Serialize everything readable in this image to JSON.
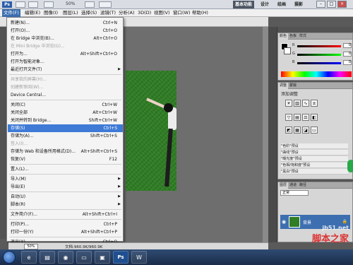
{
  "titlebar": {
    "logo": "Ps",
    "zoom": "50%",
    "workspaces": [
      "基本功能",
      "设计",
      "绘画",
      "摄影"
    ],
    "window_controls": [
      "–",
      "□",
      "×"
    ]
  },
  "menubar": [
    "文件(F)",
    "编辑(E)",
    "图像(I)",
    "图层(L)",
    "选择(S)",
    "滤镜(T)",
    "分析(A)",
    "3D(D)",
    "视图(V)",
    "窗口(W)",
    "帮助(H)"
  ],
  "file_menu": [
    {
      "label": "新建(N)...",
      "shortcut": "Ctrl+N",
      "disabled": false
    },
    {
      "label": "打开(O)...",
      "shortcut": "Ctrl+O",
      "disabled": false
    },
    {
      "label": "在 Bridge 中浏览(B)...",
      "shortcut": "Alt+Ctrl+O",
      "disabled": false
    },
    {
      "label": "在 Mini Bridge 中浏览(G)...",
      "shortcut": "",
      "disabled": true
    },
    {
      "label": "打开为...",
      "shortcut": "Alt+Shift+Ctrl+O",
      "disabled": false
    },
    {
      "label": "打开为智能对象...",
      "shortcut": "",
      "disabled": false
    },
    {
      "label": "最近打开文件(T)",
      "shortcut": "",
      "disabled": false,
      "submenu": true
    },
    {
      "sep": true
    },
    {
      "label": "共享我的屏幕(H)...",
      "shortcut": "",
      "disabled": true
    },
    {
      "label": "创建新审阅(W)...",
      "shortcut": "",
      "disabled": true
    },
    {
      "label": "Device Central...",
      "shortcut": "",
      "disabled": false
    },
    {
      "sep": true
    },
    {
      "label": "关闭(C)",
      "shortcut": "Ctrl+W",
      "disabled": false
    },
    {
      "label": "关闭全部",
      "shortcut": "Alt+Ctrl+W",
      "disabled": false
    },
    {
      "label": "关闭并转到 Bridge...",
      "shortcut": "Shift+Ctrl+W",
      "disabled": false
    },
    {
      "label": "存储(S)",
      "shortcut": "Ctrl+S",
      "disabled": false,
      "highlight": true
    },
    {
      "label": "存储为(A)...",
      "shortcut": "Shift+Ctrl+S",
      "disabled": false
    },
    {
      "label": "签入(I)...",
      "shortcut": "",
      "disabled": true
    },
    {
      "label": "存储为 Web 和设备所用格式(D)...",
      "shortcut": "Alt+Shift+Ctrl+S",
      "disabled": false
    },
    {
      "label": "恢复(V)",
      "shortcut": "F12",
      "disabled": false
    },
    {
      "sep": true
    },
    {
      "label": "置入(L)...",
      "shortcut": "",
      "disabled": false
    },
    {
      "sep": true
    },
    {
      "label": "导入(M)",
      "shortcut": "",
      "disabled": false,
      "submenu": true
    },
    {
      "label": "导出(E)",
      "shortcut": "",
      "disabled": false,
      "submenu": true
    },
    {
      "sep": true
    },
    {
      "label": "自动(U)",
      "shortcut": "",
      "disabled": false,
      "submenu": true
    },
    {
      "label": "脚本(R)",
      "shortcut": "",
      "disabled": false,
      "submenu": true
    },
    {
      "sep": true
    },
    {
      "label": "文件简介(F)...",
      "shortcut": "Alt+Shift+Ctrl+I",
      "disabled": false
    },
    {
      "sep": true
    },
    {
      "label": "打印(P)...",
      "shortcut": "Ctrl+P",
      "disabled": false
    },
    {
      "label": "打印一份(Y)",
      "shortcut": "Alt+Shift+Ctrl+P",
      "disabled": false
    },
    {
      "sep": true
    },
    {
      "label": "退出(X)",
      "shortcut": "Ctrl+Q",
      "disabled": false
    }
  ],
  "color_panel": {
    "tabs": [
      "颜色",
      "色板",
      "样式"
    ],
    "rows": [
      {
        "label": "R",
        "value": "0"
      },
      {
        "label": "G",
        "value": "0"
      },
      {
        "label": "B",
        "value": "0"
      }
    ]
  },
  "adjust_panel": {
    "tabs": [
      "调整",
      "蒙版"
    ],
    "title": "添加调整",
    "presets": [
      "\"色阶\"预设",
      "\"曲线\"预设",
      "\"曝光度\"预设",
      "\"色相/饱和度\"预设",
      "\"黑白\"预设"
    ]
  },
  "layers_panel": {
    "tabs": [
      "图层",
      "通道",
      "路径"
    ],
    "blend_mode": "正常",
    "layer_name": "背景"
  },
  "statusbar": {
    "zoom": "50%",
    "doc": "文档:960.9K/960.9K"
  },
  "watermark": {
    "site": "jb51.net",
    "brand": "脚本之家"
  }
}
